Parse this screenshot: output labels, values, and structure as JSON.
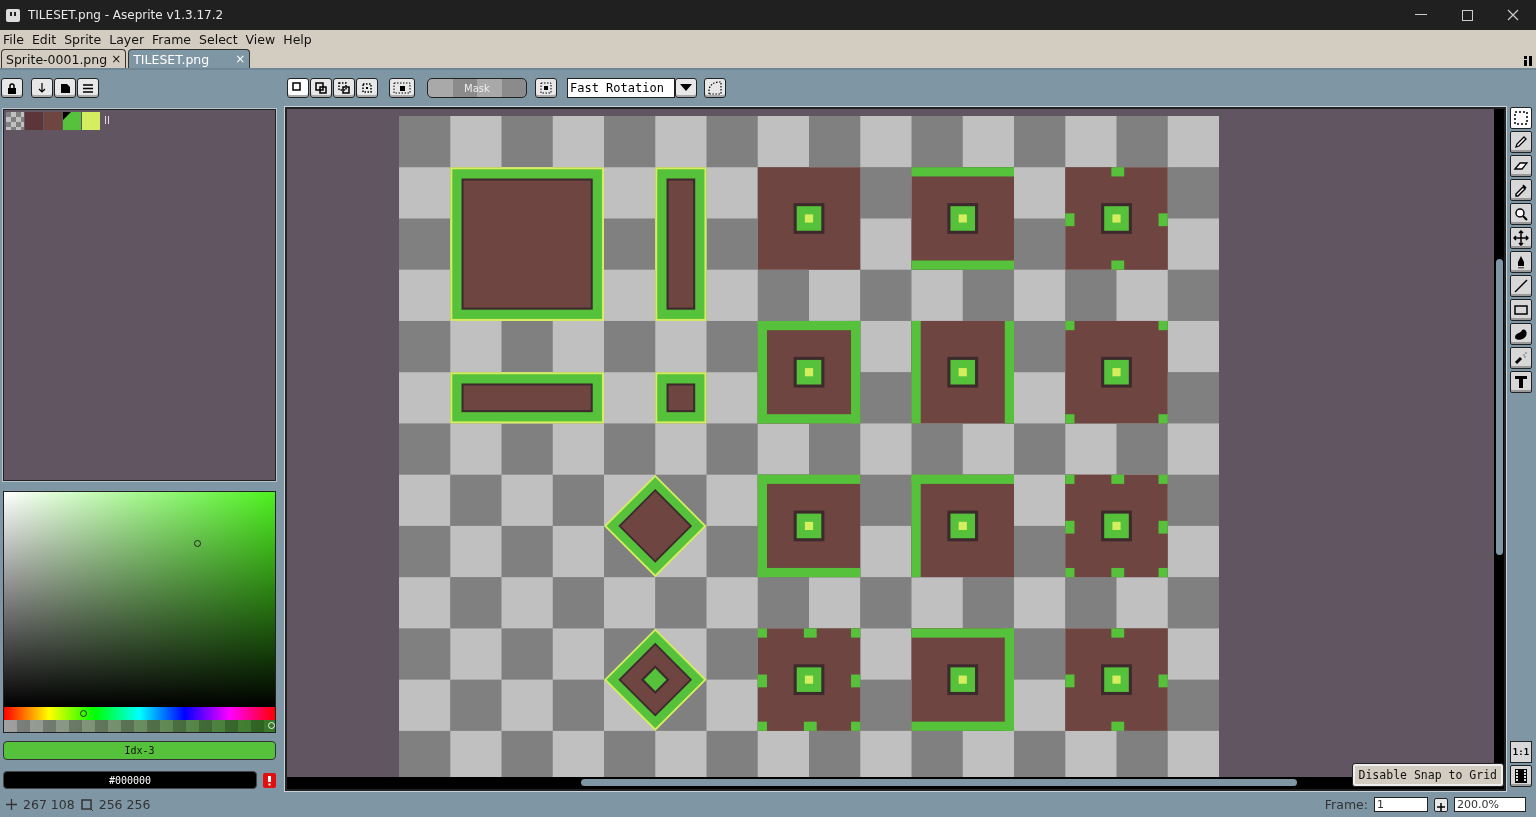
{
  "window": {
    "title": "TILESET.png - Aseprite v1.3.17.2"
  },
  "menu": [
    "File",
    "Edit",
    "Sprite",
    "Layer",
    "Frame",
    "Select",
    "View",
    "Help"
  ],
  "tabs": [
    {
      "label": "Sprite-0001.png",
      "close": "×",
      "selected": false
    },
    {
      "label": "TILESET.png",
      "close": "×",
      "selected": true
    }
  ],
  "toolbar": {
    "mask": "Mask",
    "rotation": "Fast Rotation"
  },
  "palette": [
    {
      "kind": "transparent",
      "selected": false
    },
    {
      "kind": "swatch",
      "color": "#5b3538",
      "selected": false
    },
    {
      "kind": "swatch",
      "color": "#6e4540",
      "selected": false
    },
    {
      "kind": "swatch",
      "color": "#56c13a",
      "selected": true
    },
    {
      "kind": "swatch",
      "color": "#d4ee5f",
      "selected": false
    }
  ],
  "hue_slider": {
    "level": 0.29
  },
  "alpha_slider": {
    "level": 1
  },
  "color_index": "Idx-3",
  "hex": "#000000",
  "tools": [
    {
      "kind": "select",
      "selected": true
    },
    {
      "kind": "pencil",
      "selected": false
    },
    {
      "kind": "eraser",
      "selected": false
    },
    {
      "kind": "eyedropper",
      "selected": false
    },
    {
      "kind": "zoom",
      "selected": false
    },
    {
      "kind": "move",
      "selected": false
    },
    {
      "kind": "fill",
      "selected": false
    },
    {
      "kind": "line",
      "selected": false
    },
    {
      "kind": "rectangle",
      "selected": false
    },
    {
      "kind": "blob",
      "selected": false
    },
    {
      "kind": "spray",
      "selected": false
    },
    {
      "kind": "text",
      "selected": false
    }
  ],
  "one_to_one": "1:1",
  "tooltip": "Disable Snap to Grid",
  "status": {
    "position": "267 108",
    "size": "256 256",
    "frame_label": "Frame:",
    "frame": "1",
    "zoom": "200.0%"
  }
}
